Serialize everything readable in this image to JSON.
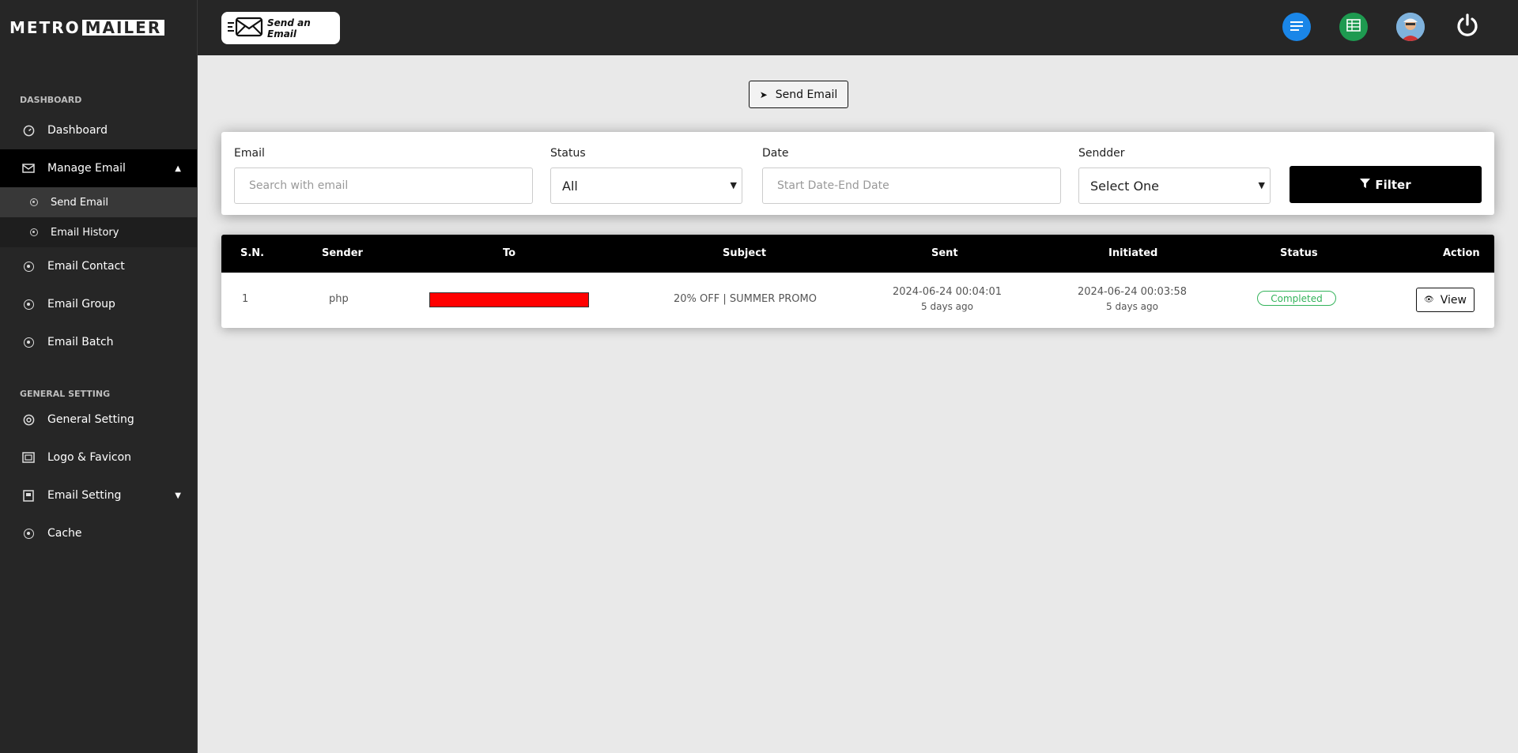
{
  "brand": {
    "part1": "METRO",
    "part2": "MAILER"
  },
  "header": {
    "logo_text": "Send an Email",
    "icons": [
      "list-icon",
      "spreadsheet-icon",
      "avatar",
      "power-icon"
    ],
    "colors": {
      "list": "#1a86e8",
      "sheet": "#1e9a50"
    }
  },
  "sidebar": {
    "section_dashboard": "DASHBOARD",
    "section_general": "GENERAL SETTING",
    "items": {
      "dashboard": "Dashboard",
      "manage_email": "Manage Email",
      "send_email": "Send Email",
      "email_history": "Email History",
      "email_contact": "Email Contact",
      "email_group": "Email Group",
      "email_batch": "Email Batch",
      "general_setting": "General Setting",
      "logo_favicon": "Logo & Favicon",
      "email_setting": "Email Setting",
      "cache": "Cache"
    }
  },
  "actions": {
    "send_email": "Send Email"
  },
  "filter": {
    "email_label": "Email",
    "email_placeholder": "Search with email",
    "status_label": "Status",
    "status_value": "All",
    "date_label": "Date",
    "date_placeholder": "Start Date-End Date",
    "sender_label": "Sendder",
    "sender_value": "Select One",
    "button": "Filter"
  },
  "table": {
    "headers": [
      "S.N.",
      "Sender",
      "To",
      "Subject",
      "Sent",
      "Initiated",
      "Status",
      "Action"
    ],
    "rows": [
      {
        "sn": "1",
        "sender": "php",
        "subject": "20% OFF | SUMMER PROMO",
        "sent": "2024-06-24 00:04:01",
        "sent_ago": "5 days ago",
        "initiated": "2024-06-24 00:03:58",
        "initiated_ago": "5 days ago",
        "status": "Completed",
        "action": "View"
      }
    ]
  }
}
